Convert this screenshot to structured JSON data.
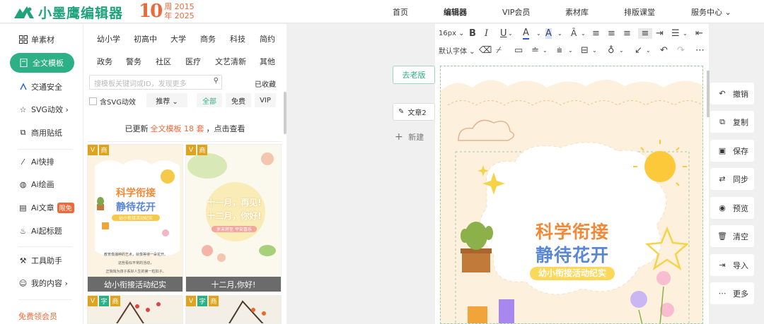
{
  "app": {
    "logo_text": "小墨鹰编辑器",
    "anniv_num": "10",
    "anniv_line1": "周 2015",
    "anniv_line2": "年 2025"
  },
  "nav": {
    "items": [
      "首页",
      "编辑器",
      "VIP会员",
      "素材库",
      "排版课堂",
      "服务中心 ⌄"
    ]
  },
  "leftnav": {
    "items": [
      "单素材",
      "全文模板",
      "交通安全",
      "SVG动效 ›",
      "商用贴纸",
      "Ai快排",
      "Ai绘画",
      "Ai文章",
      "Ai起标题",
      "工具助手",
      "我的内容 ›",
      "免费领会员"
    ],
    "badge": "限免",
    "accent": "#2eb087"
  },
  "categories": {
    "row1": [
      "幼小学",
      "初高中",
      "大学",
      "商务",
      "科技",
      "简约"
    ],
    "row2": [
      "政务",
      "警务",
      "社区",
      "医疗",
      "文艺清新",
      "其他"
    ]
  },
  "search": {
    "placeholder": "搜模板关键词或ID，发现更多",
    "fav": "已收藏"
  },
  "filters": {
    "svg": "含SVG动效",
    "sort": "推荐 ⌄",
    "all": "全部",
    "free": "免费",
    "vip": "VIP"
  },
  "notice": {
    "prefix": "已更新",
    "highlight": "全文模板 18 套",
    "suffix": "，点击查看"
  },
  "cards": [
    {
      "caption": "幼小衔接活动纪实",
      "tag1": "V",
      "tag2": "商",
      "title1": "科学衔接",
      "title2": "静待花开",
      "sub": "幼小衔接活动纪实",
      "body1": "教育像播种的艺术，就像等待一朵花开。",
      "body2": "这些看似平常的活动，",
      "body3": "正悄悄为孩子系好人生的第一粒扣子。"
    },
    {
      "caption": "十二月,你好!",
      "tag1": "V",
      "tag2": "商",
      "title1": "十一月，再见!",
      "title2": "十二月，你好!",
      "sub": "岁末将至 平安喜乐"
    }
  ],
  "cards_row2": {
    "tag1": "V",
    "tag2": "字",
    "tag3": "商"
  },
  "canvas": {
    "old_version": "去老版",
    "doc_tab": "文章2",
    "new_doc": "新建"
  },
  "toolbar": {
    "font_size": "16px ⌄",
    "font_family": "默认字体 ⌄"
  },
  "page": {
    "title1": "科学衔接",
    "title2": "静待花开",
    "subtitle": "幼小衔接活动纪实"
  },
  "rightpanel": {
    "items": [
      "撤销",
      "复制",
      "保存",
      "同步",
      "预览",
      "清空",
      "导入",
      "更多"
    ]
  }
}
